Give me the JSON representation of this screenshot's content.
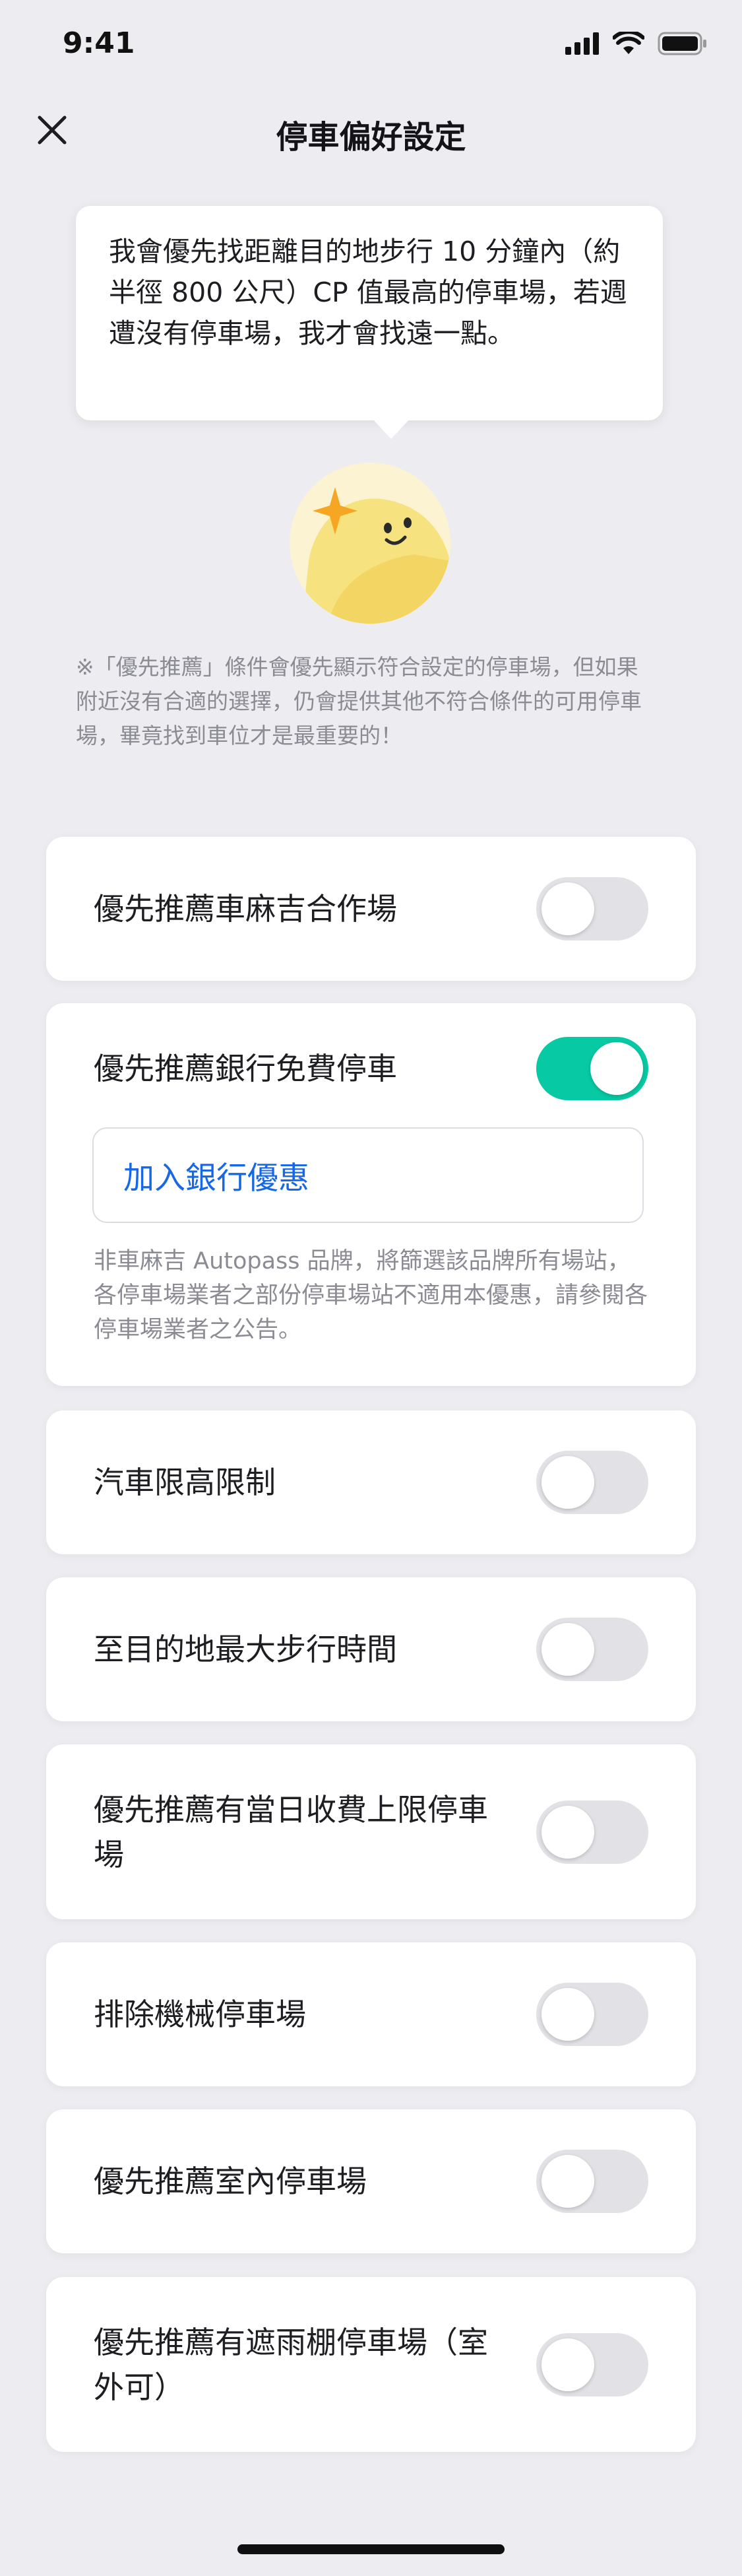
{
  "status_bar": {
    "time": "9:41",
    "icons": [
      "cellular-signal-icon",
      "wifi-icon",
      "battery-icon"
    ]
  },
  "header": {
    "title": "停車偏好設定",
    "close_icon": "close-icon"
  },
  "intro": {
    "bubble_text": "我會優先找距離目的地步行 10 分鐘內（約半徑 800 公尺）CP 值最高的停車場，若週遭沒有停車場，我才會找遠一點。",
    "mascot_icon": "sparkle-mascot-icon",
    "note": "※「優先推薦」條件會優先顯示符合設定的停車場，但如果附近沒有合適的選擇，仍會提供其他不符合條件的可用停車場，畢竟找到車位才是最重要的！"
  },
  "settings": [
    {
      "label": "優先推薦車麻吉合作場",
      "enabled": false
    },
    {
      "label": "優先推薦銀行免費停車",
      "enabled": true,
      "action_label": "加入銀行優惠",
      "note": "非車麻吉 Autopass 品牌，將篩選該品牌所有場站，各停車場業者之部份停車場站不適用本優惠，請參閱各停車場業者之公告。"
    },
    {
      "label": "汽車限高限制",
      "enabled": false
    },
    {
      "label": "至目的地最大步行時間",
      "enabled": false
    },
    {
      "label": "優先推薦有當日收費上限停車場",
      "enabled": false
    },
    {
      "label": "排除機械停車場",
      "enabled": false
    },
    {
      "label": "優先推薦室內停車場",
      "enabled": false
    },
    {
      "label": "優先推薦有遮雨棚停車場（室外可）",
      "enabled": false
    }
  ],
  "colors": {
    "background": "#ededf1",
    "toggle_on": "#07c9a3",
    "toggle_off": "#e2e2e6",
    "link": "#1768e6",
    "note_text": "#8b8b93"
  }
}
